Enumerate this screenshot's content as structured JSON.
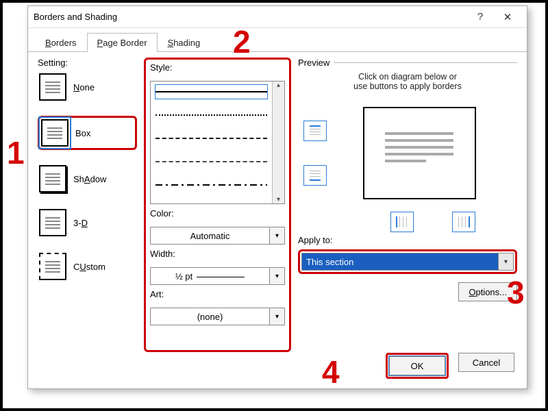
{
  "window": {
    "title": "Borders and Shading",
    "help": "?",
    "close": "✕"
  },
  "tabs": {
    "borders": "Borders",
    "page_border": "Page Border",
    "shading": "Shading",
    "borders_ul": "B",
    "page_border_ul": "P",
    "shading_ul": "S"
  },
  "setting": {
    "label": "Setting:",
    "none": "None",
    "box": "Box",
    "shadow": "Shadow",
    "threed": "3-D",
    "custom": "Custom",
    "none_ul": "N",
    "shadow_ul": "A",
    "threed_ul": "D",
    "custom_ul": "U"
  },
  "style": {
    "label": "Style:",
    "color_label": "Color:",
    "color_value": "Automatic",
    "width_label": "Width:",
    "width_value": "½ pt",
    "art_label": "Art:",
    "art_value": "(none)"
  },
  "preview": {
    "label": "Preview",
    "hint1": "Click on diagram below or",
    "hint2": "use buttons to apply borders",
    "apply_label": "Apply to:",
    "apply_value": "This section",
    "options": "Options...",
    "options_ul": "O"
  },
  "footer": {
    "ok": "OK",
    "cancel": "Cancel"
  },
  "annotations": {
    "n1": "1",
    "n2": "2",
    "n3": "3",
    "n4": "4"
  }
}
